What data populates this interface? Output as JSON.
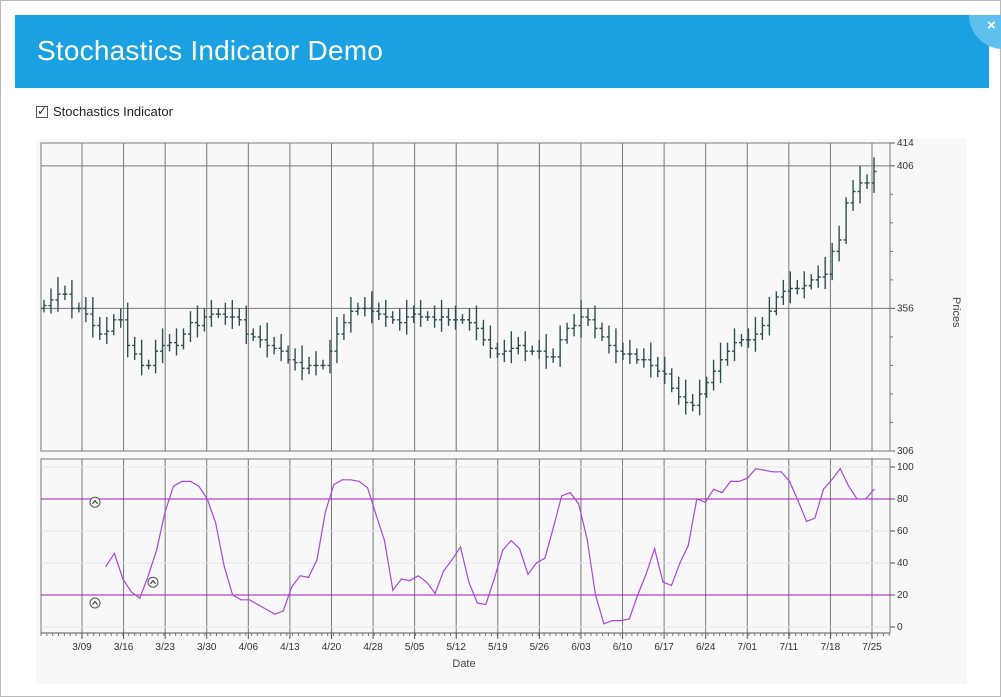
{
  "window": {
    "title": "Stochastics Indicator Demo",
    "close_glyph": "×"
  },
  "toggle": {
    "label": "Stochastics Indicator",
    "checked": true
  },
  "colors": {
    "accent": "#1ba1e2",
    "bar": "#2f4f4f",
    "stoch": "#a44bd1",
    "threshold": "#9b1fb0",
    "grid": "#777777"
  },
  "chart_data": [
    {
      "type": "ohlc",
      "title": "",
      "ylabel": "Prices",
      "xlabel": "",
      "ylim": [
        306,
        414
      ],
      "yticks": [
        306,
        356,
        406,
        414
      ],
      "x_tick_labels": [
        "3/09",
        "3/16",
        "3/23",
        "3/30",
        "4/06",
        "4/13",
        "4/20",
        "4/28",
        "5/05",
        "5/12",
        "5/19",
        "5/26",
        "6/03",
        "6/10",
        "6/17",
        "6/24",
        "7/01",
        "7/11",
        "7/18",
        "7/25"
      ],
      "close": [
        357,
        359,
        361,
        361,
        356,
        356,
        354,
        350,
        347,
        348,
        352,
        352,
        343,
        340,
        336,
        336,
        341,
        343,
        344,
        343,
        347,
        351,
        350,
        353,
        354,
        354,
        353,
        353,
        352,
        347,
        346,
        345,
        343,
        342,
        341,
        338,
        337,
        335,
        336,
        336,
        336,
        341,
        347,
        351,
        355,
        356,
        356,
        355,
        354,
        353,
        352,
        351,
        353,
        354,
        353,
        353,
        352,
        353,
        352,
        352,
        352,
        351,
        349,
        345,
        342,
        340,
        341,
        342,
        343,
        341,
        341,
        341,
        339,
        339,
        345,
        349,
        350,
        353,
        352,
        349,
        346,
        343,
        341,
        340,
        340,
        338,
        338,
        336,
        334,
        333,
        328,
        325,
        323,
        322,
        326,
        330,
        334,
        338,
        341,
        344,
        345,
        345,
        347,
        350,
        355,
        360,
        362,
        363,
        363,
        364,
        366,
        367,
        368,
        376,
        380,
        393,
        397,
        400,
        400,
        404
      ]
    },
    {
      "type": "line",
      "title": "",
      "xlabel": "Date",
      "ylabel": "",
      "ylim": [
        0,
        100
      ],
      "yticks": [
        0,
        20,
        40,
        60,
        80,
        100
      ],
      "thresholds": [
        80,
        20
      ],
      "values": [
        38,
        46,
        30,
        22,
        18,
        32,
        48,
        72,
        88,
        91,
        91,
        88,
        80,
        65,
        38,
        20,
        17,
        17,
        14,
        11,
        8,
        10,
        25,
        32,
        31,
        42,
        72,
        89,
        92,
        92,
        91,
        87,
        70,
        54,
        23,
        30,
        29,
        32,
        28,
        21,
        35,
        42,
        50,
        28,
        15,
        14,
        30,
        48,
        54,
        49,
        33,
        40,
        43,
        62,
        82,
        84,
        77,
        55,
        20,
        2,
        4,
        4,
        5,
        20,
        33,
        49,
        28,
        26,
        40,
        51,
        80,
        78,
        86,
        84,
        91,
        91,
        93,
        99,
        98,
        97,
        97,
        91,
        79,
        66,
        68,
        86,
        92,
        99,
        88,
        80,
        80,
        86
      ]
    }
  ]
}
